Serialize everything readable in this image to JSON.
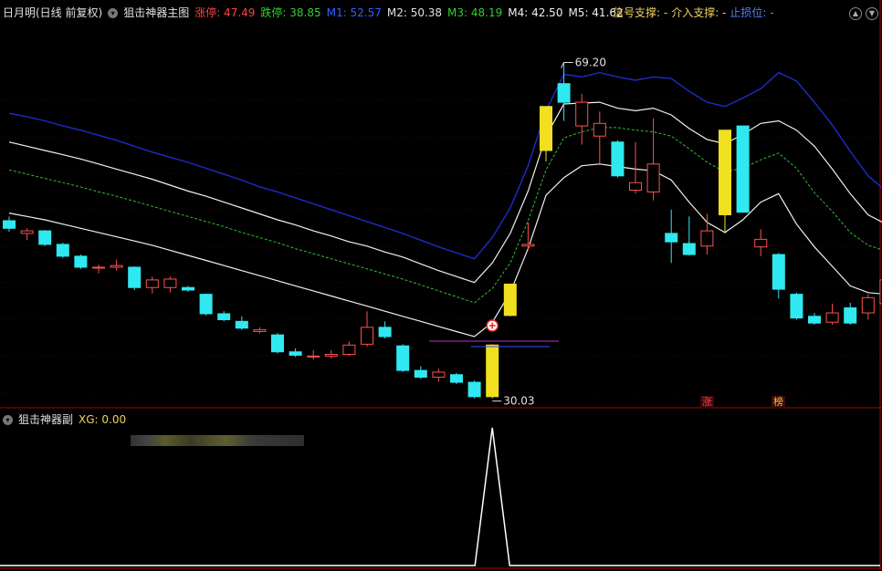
{
  "main_header": {
    "stock": "日月明(日线 前复权)",
    "indicator": "狙击神器主图",
    "items": [
      {
        "label": "涨停: 47.49",
        "color": "#ff4040"
      },
      {
        "label": "跌停: 38.85",
        "color": "#30d030"
      },
      {
        "label": "M1: 52.57",
        "color": "#3060ff"
      },
      {
        "label": "M2: 50.38",
        "color": "#e0e0e0"
      },
      {
        "label": "M3: 48.19",
        "color": "#30d030"
      },
      {
        "label": "M4: 42.50",
        "color": "#f0f0f0"
      },
      {
        "label": "M5: 41.62",
        "color": "#f0f0f0"
      }
    ]
  },
  "right_header": {
    "signal_support": "信号支撑: -",
    "entry_support": "介入支撑: -",
    "stop_loss": "止损位: -"
  },
  "sub_header": {
    "indicator": "狙击神器副",
    "xg": "XG: 0.00"
  },
  "annotations": {
    "high_label": "69.20",
    "low_label": "30.03",
    "badge_zhang": "涨",
    "badge_bang": "榜"
  },
  "chart_data": {
    "type": "candlestick",
    "y_range": [
      28.5,
      74.0
    ],
    "candles": [
      {
        "o": 50.5,
        "h": 51.0,
        "l": 49.2,
        "c": 49.6,
        "color": "cyan"
      },
      {
        "o": 49.0,
        "h": 49.6,
        "l": 48.2,
        "c": 49.3,
        "color": "red"
      },
      {
        "o": 49.3,
        "h": 49.4,
        "l": 47.5,
        "c": 47.7,
        "color": "cyan"
      },
      {
        "o": 47.7,
        "h": 47.9,
        "l": 46.1,
        "c": 46.3,
        "color": "cyan"
      },
      {
        "o": 46.3,
        "h": 46.5,
        "l": 44.8,
        "c": 45.0,
        "color": "cyan"
      },
      {
        "o": 44.9,
        "h": 45.3,
        "l": 44.3,
        "c": 45.0,
        "color": "red"
      },
      {
        "o": 45.0,
        "h": 45.9,
        "l": 44.6,
        "c": 45.2,
        "color": "red"
      },
      {
        "o": 45.0,
        "h": 45.1,
        "l": 42.3,
        "c": 42.6,
        "color": "cyan"
      },
      {
        "o": 42.6,
        "h": 43.9,
        "l": 41.9,
        "c": 43.5,
        "color": "red"
      },
      {
        "o": 42.6,
        "h": 43.9,
        "l": 42.0,
        "c": 43.6,
        "color": "red"
      },
      {
        "o": 42.6,
        "h": 42.8,
        "l": 42.1,
        "c": 42.3,
        "color": "cyan"
      },
      {
        "o": 41.8,
        "h": 41.9,
        "l": 39.3,
        "c": 39.5,
        "color": "cyan"
      },
      {
        "o": 39.5,
        "h": 39.8,
        "l": 38.6,
        "c": 38.8,
        "color": "cyan"
      },
      {
        "o": 38.6,
        "h": 39.2,
        "l": 37.6,
        "c": 37.8,
        "color": "cyan"
      },
      {
        "o": 37.6,
        "h": 37.9,
        "l": 37.2,
        "c": 37.4,
        "color": "red"
      },
      {
        "o": 37.0,
        "h": 37.2,
        "l": 34.8,
        "c": 35.0,
        "color": "cyan"
      },
      {
        "o": 35.0,
        "h": 35.4,
        "l": 34.4,
        "c": 34.6,
        "color": "cyan"
      },
      {
        "o": 34.5,
        "h": 35.2,
        "l": 34.1,
        "c": 34.5,
        "color": "red"
      },
      {
        "o": 34.5,
        "h": 35.2,
        "l": 34.2,
        "c": 34.7,
        "color": "red"
      },
      {
        "o": 34.7,
        "h": 36.2,
        "l": 34.5,
        "c": 35.8,
        "color": "red"
      },
      {
        "o": 35.9,
        "h": 39.8,
        "l": 35.6,
        "c": 37.9,
        "color": "red"
      },
      {
        "o": 37.9,
        "h": 38.6,
        "l": 36.6,
        "c": 36.8,
        "color": "cyan"
      },
      {
        "o": 35.7,
        "h": 35.9,
        "l": 32.6,
        "c": 32.8,
        "color": "cyan"
      },
      {
        "o": 32.8,
        "h": 33.3,
        "l": 31.8,
        "c": 32.0,
        "color": "cyan"
      },
      {
        "o": 32.0,
        "h": 33.0,
        "l": 31.5,
        "c": 32.6,
        "color": "red"
      },
      {
        "o": 32.3,
        "h": 32.5,
        "l": 31.2,
        "c": 31.4,
        "color": "cyan"
      },
      {
        "o": 31.4,
        "h": 31.6,
        "l": 29.5,
        "c": 29.7,
        "color": "cyan"
      },
      {
        "o": 29.7,
        "h": 35.9,
        "l": 29.5,
        "c": 35.8,
        "color": "yellow"
      },
      {
        "o": 39.3,
        "h": 43.0,
        "l": 39.2,
        "c": 43.0,
        "color": "yellow"
      },
      {
        "o": 47.5,
        "h": 50.3,
        "l": 47.0,
        "c": 47.7,
        "color": "red"
      },
      {
        "o": 58.8,
        "h": 64.0,
        "l": 57.5,
        "c": 64.0,
        "color": "yellow"
      },
      {
        "o": 66.7,
        "h": 69.2,
        "l": 62.3,
        "c": 64.5,
        "color": "cyan"
      },
      {
        "o": 61.7,
        "h": 65.5,
        "l": 59.5,
        "c": 64.5,
        "color": "red"
      },
      {
        "o": 62.0,
        "h": 63.4,
        "l": 57.3,
        "c": 60.5,
        "color": "red"
      },
      {
        "o": 59.8,
        "h": 60.0,
        "l": 55.6,
        "c": 55.8,
        "color": "cyan"
      },
      {
        "o": 54.1,
        "h": 59.8,
        "l": 53.7,
        "c": 55.0,
        "color": "red"
      },
      {
        "o": 53.9,
        "h": 62.6,
        "l": 52.9,
        "c": 57.2,
        "color": "red"
      },
      {
        "o": 49.0,
        "h": 51.8,
        "l": 45.5,
        "c": 48.0,
        "color": "cyan"
      },
      {
        "o": 47.8,
        "h": 51.0,
        "l": 46.4,
        "c": 46.5,
        "color": "cyan"
      },
      {
        "o": 47.5,
        "h": 51.3,
        "l": 46.5,
        "c": 49.3,
        "color": "red"
      },
      {
        "o": 51.2,
        "h": 61.2,
        "l": 49.0,
        "c": 61.2,
        "color": "yellow"
      },
      {
        "o": 61.7,
        "h": 61.7,
        "l": 51.5,
        "c": 51.5,
        "color": "cyan"
      },
      {
        "o": 47.4,
        "h": 49.5,
        "l": 46.3,
        "c": 48.3,
        "color": "red"
      },
      {
        "o": 46.5,
        "h": 46.7,
        "l": 41.3,
        "c": 42.4,
        "color": "cyan"
      },
      {
        "o": 41.8,
        "h": 42.0,
        "l": 38.8,
        "c": 39.0,
        "color": "cyan"
      },
      {
        "o": 39.2,
        "h": 39.6,
        "l": 38.2,
        "c": 38.4,
        "color": "cyan"
      },
      {
        "o": 38.5,
        "h": 40.7,
        "l": 38.2,
        "c": 39.6,
        "color": "red"
      },
      {
        "o": 40.2,
        "h": 40.8,
        "l": 38.2,
        "c": 38.4,
        "color": "cyan"
      },
      {
        "o": 39.6,
        "h": 41.8,
        "l": 38.8,
        "c": 41.4,
        "color": "red"
      },
      {
        "o": 40.7,
        "h": 44.1,
        "l": 40.2,
        "c": 43.5,
        "color": "red"
      }
    ],
    "lines": {
      "blue": [
        63.2,
        62.8,
        62.3,
        61.7,
        61.2,
        60.6,
        60.0,
        59.3,
        58.6,
        58.0,
        57.4,
        56.7,
        56.0,
        55.3,
        54.5,
        53.9,
        53.2,
        52.5,
        51.8,
        51.1,
        50.4,
        49.7,
        49.0,
        48.2,
        47.4,
        46.7,
        46.0,
        48.5,
        52.0,
        57.0,
        63.5,
        67.8,
        67.5,
        68.0,
        67.5,
        67.1,
        67.5,
        67.3,
        65.8,
        64.5,
        64.0,
        65.0,
        66.1,
        68.0,
        67.0,
        64.5,
        61.8,
        58.7,
        55.8,
        54.0
      ],
      "white_hi": [
        59.8,
        59.3,
        58.8,
        58.3,
        57.8,
        57.2,
        56.6,
        56.0,
        55.4,
        54.7,
        54.0,
        53.4,
        52.7,
        52.0,
        51.3,
        50.6,
        50.0,
        49.3,
        48.7,
        48.0,
        47.5,
        46.8,
        46.2,
        45.4,
        44.6,
        43.9,
        43.2,
        45.5,
        49.0,
        54.0,
        60.5,
        64.3,
        64.4,
        64.5,
        63.8,
        63.5,
        63.8,
        63.0,
        61.4,
        60.1,
        59.6,
        60.7,
        62.0,
        62.3,
        61.2,
        59.3,
        56.6,
        53.7,
        51.2,
        50.1
      ],
      "green_dash": [
        56.5,
        56.0,
        55.5,
        55.0,
        54.5,
        53.9,
        53.4,
        52.8,
        52.2,
        51.6,
        51.0,
        50.4,
        49.8,
        49.1,
        48.5,
        47.9,
        47.2,
        46.6,
        46.0,
        45.4,
        44.8,
        44.2,
        43.6,
        42.9,
        42.2,
        41.5,
        40.8,
        42.5,
        45.5,
        50.5,
        56.5,
        60.3,
        61.0,
        61.5,
        61.5,
        61.2,
        61.0,
        60.5,
        59.0,
        57.4,
        56.3,
        56.7,
        57.7,
        58.5,
        56.7,
        53.8,
        51.6,
        49.1,
        47.6,
        46.9
      ],
      "white_lo": [
        51.4,
        51.0,
        50.6,
        50.1,
        49.6,
        49.1,
        48.6,
        48.1,
        47.6,
        47.0,
        46.4,
        45.8,
        45.2,
        44.6,
        44.0,
        43.4,
        42.8,
        42.2,
        41.6,
        41.0,
        40.4,
        39.8,
        39.2,
        38.6,
        38.0,
        37.4,
        36.8,
        38.5,
        42.0,
        47.2,
        53.5,
        55.6,
        57.0,
        57.2,
        56.9,
        56.6,
        56.4,
        55.3,
        52.7,
        50.3,
        49.1,
        50.6,
        52.7,
        53.7,
        50.1,
        47.4,
        45.1,
        42.8,
        42.0,
        41.8
      ]
    },
    "signal_spike_index": 27
  }
}
